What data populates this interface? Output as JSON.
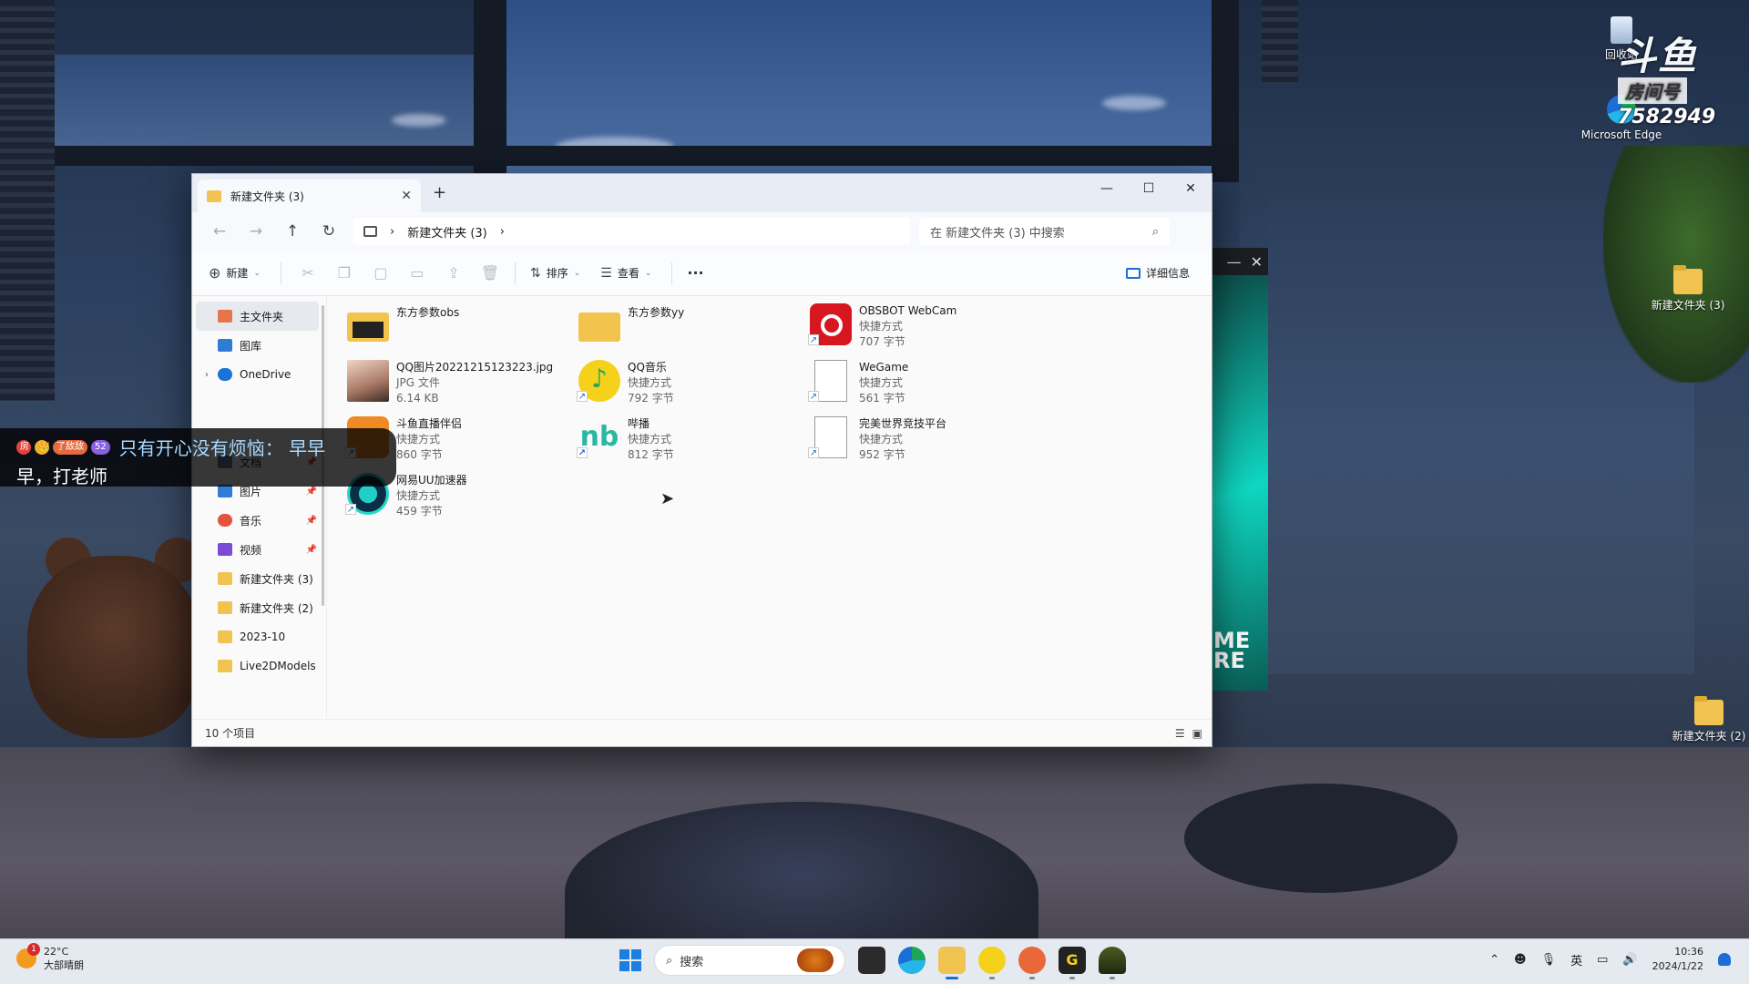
{
  "desktop": {
    "icons": [
      {
        "label": "回收站",
        "icon": "recycle-bin-icon"
      },
      {
        "label": "Microsoft Edge",
        "icon": "edge-icon"
      },
      {
        "label": "新建文件夹 (3)",
        "icon": "folder-icon"
      },
      {
        "label": "新建文件夹 (2)",
        "icon": "folder-icon"
      }
    ],
    "room_badge": {
      "logo": "斗鱼",
      "label": "房间号",
      "number": "7582949"
    }
  },
  "side_overlay": {
    "text_line1": "ME",
    "text_line2": "RE"
  },
  "explorer": {
    "tab_title": "新建文件夹 (3)",
    "breadcrumb": [
      "新建文件夹 (3)"
    ],
    "search_placeholder": "在 新建文件夹 (3) 中搜索",
    "toolbar": {
      "new_label": "新建",
      "sort_label": "排序",
      "view_label": "查看",
      "details_label": "详细信息"
    },
    "sidebar": [
      {
        "label": "主文件夹",
        "icon": "home-icon",
        "color": "#e6764a",
        "active": true
      },
      {
        "label": "图库",
        "icon": "gallery-icon",
        "color": "#2f7cd6"
      },
      {
        "label": "OneDrive",
        "icon": "cloud-icon",
        "color": "#1a73d9",
        "expandable": true
      },
      {
        "label": "文档",
        "icon": "document-icon",
        "color": "#5f7fa6",
        "pinned": true
      },
      {
        "label": "图片",
        "icon": "pictures-icon",
        "color": "#2f7cd6",
        "pinned": true
      },
      {
        "label": "音乐",
        "icon": "music-icon",
        "color": "#e2543b",
        "pinned": true
      },
      {
        "label": "视频",
        "icon": "video-icon",
        "color": "#7b4bd6",
        "pinned": true
      },
      {
        "label": "新建文件夹 (3)",
        "icon": "folder-icon",
        "color": "#f1c452"
      },
      {
        "label": "新建文件夹 (2)",
        "icon": "folder-icon",
        "color": "#f1c452"
      },
      {
        "label": "2023-10",
        "icon": "folder-icon",
        "color": "#f1c452"
      },
      {
        "label": "Live2DModels",
        "icon": "folder-icon",
        "color": "#f1c452"
      }
    ],
    "files": [
      {
        "name": "东方参数obs",
        "type": "",
        "size": "",
        "icon": "folder-icon"
      },
      {
        "name": "东方参数yy",
        "type": "",
        "size": "",
        "icon": "folder-icon"
      },
      {
        "name": "OBSBOT WebCam",
        "type": "快捷方式",
        "size": "707 字节",
        "icon": "obsbot-icon"
      },
      {
        "name": "QQ图片20221215123223.jpg",
        "type": "JPG 文件",
        "size": "6.14 KB",
        "icon": "photo-thumbnail"
      },
      {
        "name": "QQ音乐",
        "type": "快捷方式",
        "size": "792 字节",
        "icon": "qqmusic-icon"
      },
      {
        "name": "WeGame",
        "type": "快捷方式",
        "size": "561 字节",
        "icon": "blank-file-icon"
      },
      {
        "name": "斗鱼直播伴侣",
        "type": "快捷方式",
        "size": "860 字节",
        "icon": "douyu-icon"
      },
      {
        "name": "哔播",
        "type": "快捷方式",
        "size": "812 字节",
        "icon": "bibo-icon"
      },
      {
        "name": "完美世界竞技平台",
        "type": "快捷方式",
        "size": "952 字节",
        "icon": "blank-file-icon"
      },
      {
        "name": "网易UU加速器",
        "type": "快捷方式",
        "size": "459 字节",
        "icon": "uu-icon"
      }
    ],
    "status": "10 个项目"
  },
  "danmaku": {
    "badges": [
      "房",
      "👑",
      "了敌敌",
      "52"
    ],
    "message_line1": "只有开心没有烦恼：  早早",
    "message_line2": "早，打老师"
  },
  "taskbar": {
    "weather_temp": "22°C",
    "weather_desc": "大部晴朗",
    "weather_badge": "1",
    "search_label": "搜索",
    "lang": "英",
    "time": "10:36",
    "date": "2024/1/22"
  }
}
